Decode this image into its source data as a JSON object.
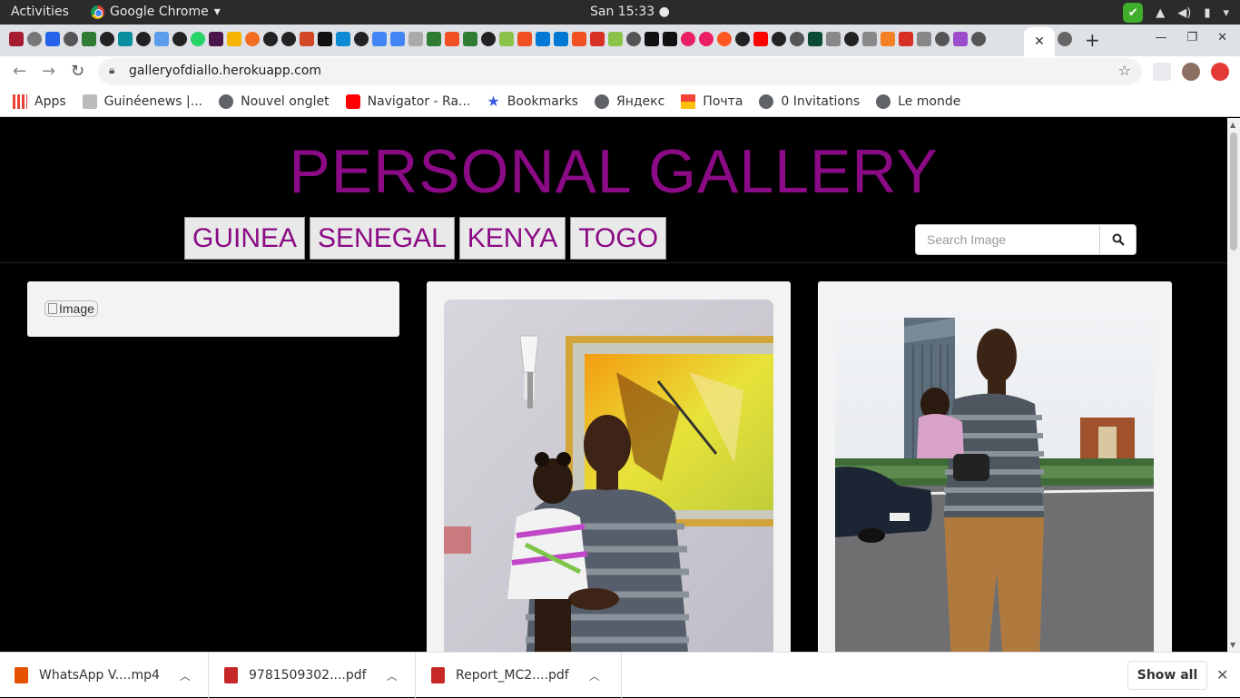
{
  "os_bar": {
    "activities": "Activities",
    "app_name": "Google Chrome",
    "clock": "San 15:33"
  },
  "browser": {
    "url": "galleryofdiallo.herokuapp.com",
    "bookmarks": [
      {
        "label": "Apps",
        "icon": "apps-grid-icon"
      },
      {
        "label": "Guinéenews |...",
        "icon": "site-icon"
      },
      {
        "label": "Nouvel onglet",
        "icon": "globe-icon"
      },
      {
        "label": "Navigator - Ra...",
        "icon": "youtube-icon"
      },
      {
        "label": "Bookmarks",
        "icon": "star-icon"
      },
      {
        "label": "Яндекс",
        "icon": "globe-icon"
      },
      {
        "label": "Почта",
        "icon": "mail-icon"
      },
      {
        "label": "0 Invitations",
        "icon": "globe-icon"
      },
      {
        "label": "Le monde",
        "icon": "globe-icon"
      }
    ]
  },
  "page": {
    "title": "PERSONAL GALLERY",
    "nav": [
      "GUINEA",
      "SENEGAL",
      "KENYA",
      "TOGO"
    ],
    "search_placeholder": "Search Image",
    "broken_image_alt": "Image",
    "accent_color": "#8b0a85"
  },
  "downloads": {
    "items": [
      {
        "name": "WhatsApp V....mp4",
        "type": "video"
      },
      {
        "name": "9781509302....pdf",
        "type": "pdf"
      },
      {
        "name": "Report_MC2....pdf",
        "type": "pdf"
      }
    ],
    "show_all": "Show all"
  }
}
